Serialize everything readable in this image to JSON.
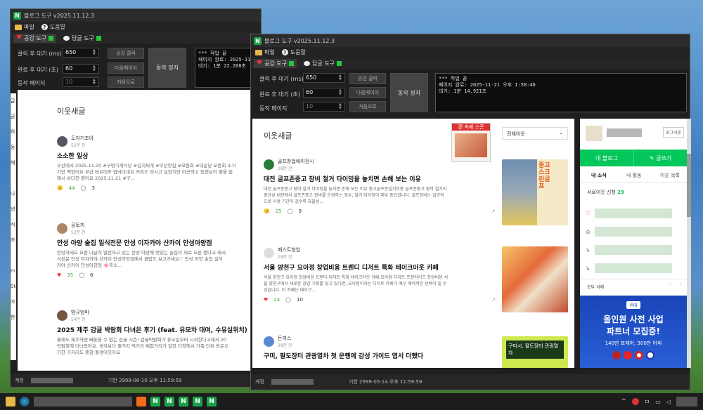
{
  "back_window": {
    "title": "블로그 도구 v2025.11.12.3",
    "menu": {
      "file": "파일",
      "help": "도움말"
    },
    "tabs": {
      "like": "공감 도구",
      "comment": "답글 도구"
    },
    "controls": {
      "click_wait_label": "클릭 후 대기 (ms)",
      "click_wait_value": "650",
      "done_wait_label": "완료 후 대기 (초)",
      "done_wait_value": "60",
      "pages_label": "동작 페이지",
      "pages_value": "10"
    },
    "buttons": {
      "like_click": "공감 클릭",
      "next_page": "다음페이지",
      "first": "처음으로",
      "stop": "동작 정지"
    },
    "log": "*** 작업 끝\n페이지 완료: 2025-11-21\n대기: 1분 22.268초",
    "feed_title": "이웃새글",
    "posts": [
      {
        "author": "도자기조아",
        "ago": "52분 전",
        "title": "소소한 일상",
        "body": "부산에서 2025.11.20 #구명가계식당 #김치찌개 #부산핫집 #모듬회 #대운당 모듬회 소거\n기반 맥었어요 부산 바로대표 밥바다네요 커피도 마시고 살았지만 따끈하고 동현님이 좋을 없\n해서 바다한 봤어요 2025.11.21 #구...",
        "likes": "44",
        "comments": "3"
      },
      {
        "author": "곰토끼",
        "ago": "53분 전",
        "title": "안성 아양 술집 일식전문 안성 이자카야 산카이 안성아양점",
        "body": "안녕하세요 요즘 나날히 발전하고 있는 안성 아양에 멋있는 술집이 새로 오픈 했다고 해서 \n식전문 안성 이자카야 산카이 안성아양점에서 클립도 보고가세요♡ 안성 아양 술집 일식\n카야 산카이 안성아양점 🌸주소...",
        "likes": "35",
        "comments": "6"
      },
      {
        "author": "밤규엄마",
        "ago": "54분 전",
        "title": "2025 제주 감귤 박람회 다녀온 후기 (feat. 유모차 대여, 수유실위치)",
        "body": "올해도 제주하면 빼놓을 수 없는 감귤 시즌! 감귤박람회가 휴오일부터 시작한다고해서 20\n박람회에 다녀왔어요. 생각보다 즐거지 먹거리 체험거리가 알찬 다양해서 가족 단위 방문으\n기한 가지러도 좋참 돌생어잇어요"
      }
    ],
    "status": {
      "account_label": "계정",
      "expiry": "기한 2999-08-10 오후 11:59:59"
    },
    "side_chars": [
      "글",
      "금",
      "하",
      "등",
      "해",
      " ",
      "나",
      "녕",
      "식",
      "카",
      " ",
      "m Ste",
      "가 한"
    ]
  },
  "front_window": {
    "title": "블로그 도구 v2025.11.12.3",
    "menu": {
      "file": "파일",
      "help": "도움말"
    },
    "tabs": {
      "like": "공감 도구",
      "comment": "답글 도구"
    },
    "controls": {
      "click_wait_label": "클릭 후 대기 (ms)",
      "click_wait_value": "650",
      "done_wait_label": "완료 후 대기 (초)",
      "done_wait_value": "60",
      "pages_label": "동작 페이지",
      "pages_value": "10"
    },
    "buttons": {
      "like_click": "공감 클릭",
      "next_page": "다음페이지",
      "first": "처음으로",
      "stop": "동작 정지"
    },
    "log": "*** 작업 끝\n페이지 완료: 2025-11-21 오후 1:58:46\n대기: 1분 14.921초",
    "feed": {
      "title": "이웃새글",
      "ad_label": "캔 속에 스콘",
      "filter": "전체이웃",
      "posts": [
        {
          "author": "골프창업에이전시",
          "ago": "28분 전",
          "title": "대전 골프존중고 장비 철거 타이밍을 놓치면 손해 보는 이유",
          "body": "대전 골프존중고 장비 철거 타이밍을 놓치면 손해 보는 이유 중고골프존설치비용 골프존중고 장비 철거의\n중요성 대전에서 골프존중고 장비를 운영하는 경우, 철거 타이밍이 매우 중요합니다. 골프장비는 일반적\n으로 사용 기간이 길수록 효율성...",
          "likes": "25",
          "comments": "9",
          "thumb_text": "중고스크린골프"
        },
        {
          "author": "베스트창업",
          "ago": "28분 전",
          "title": "서울 양천구 요아정 창업비용 트렌디 디저트 특화 테이크아웃 카페",
          "body": "서울 양천구 요아정 창업비용 트렌디 디저트 특화 테이크아웃 카페 요아정 디저트 프랜차이즈 창업비용 서\n울 양천구에서 새로운 창업 기회를 찾고 있다면, 요아정이라는 디저트 카페가 매우 매력적인 선택이 될 수\n있습니다. 이 카페는 테이크...",
          "likes": "24",
          "comments": "10"
        },
        {
          "author": "돈까스",
          "ago": "28분 전",
          "title": "구미, 팔도장터 관광열차 첫 운행에 감성 가이드 엽서 더했다",
          "thumb_text": "구미시, 팔도장터 관광열차"
        }
      ]
    },
    "sidebar": {
      "login": "로그아웃",
      "my_blog": "내 블로그",
      "write": "글쓰기",
      "tabs": [
        "내 소식",
        "내 활동",
        "이웃 목록"
      ],
      "neighbor_request": "서로이웃 신청",
      "neighbor_count": "29",
      "delete_all": "모두 삭제",
      "ad_badge": "위대",
      "ad_line1": "올인원 사전 사업",
      "ad_line2": "파트너 모집중!",
      "ad_line3": "140만 표제어, 300만 어휘"
    },
    "status": {
      "account_label": "계정",
      "expiry": "기한 2999-05-14 오후 11:59:59"
    }
  },
  "taskbar": {
    "app_letter": "N"
  }
}
